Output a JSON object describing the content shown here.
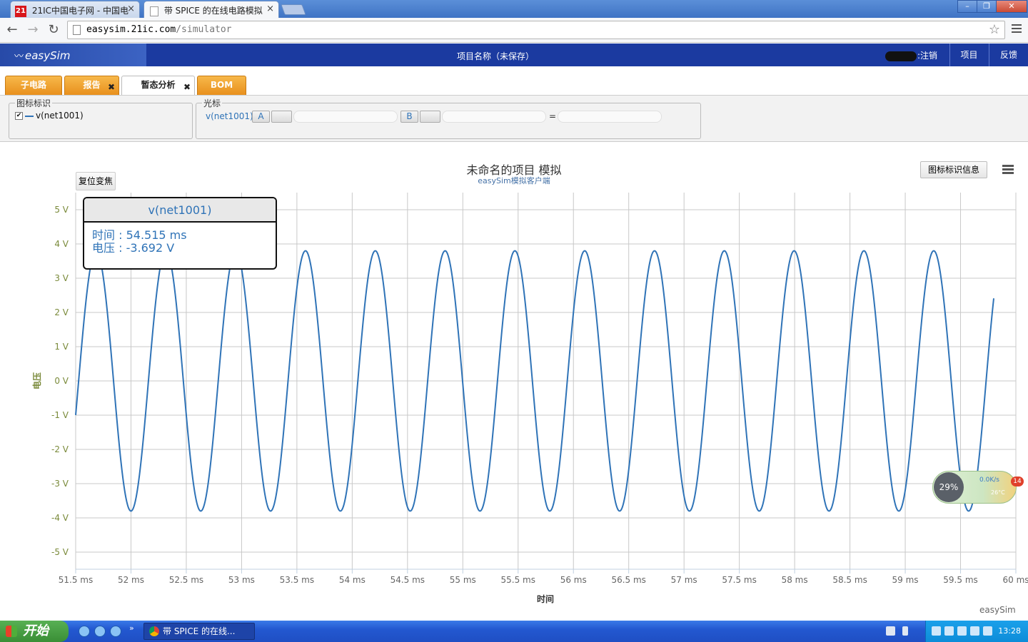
{
  "browser": {
    "tabs": [
      {
        "title": "21IC中国电子网 - 中国电",
        "favicon": "21",
        "active": false
      },
      {
        "title": "带 SPICE 的在线电路模拟",
        "favicon": "page-icon",
        "active": true
      }
    ],
    "url_host": "easysim.21ic.com",
    "url_path": "/simulator",
    "window_controls": [
      "minimize-icon",
      "maximize-icon",
      "close-icon"
    ]
  },
  "app": {
    "logo": "easySim",
    "project_title": "项目名称（未保存）",
    "user_action": ":注销",
    "nav": {
      "project": "项目",
      "feedback": "反馈"
    }
  },
  "module_tabs": [
    {
      "label": "子电路",
      "closable": false,
      "active": false
    },
    {
      "label": "报告",
      "closable": true,
      "active": false
    },
    {
      "label": "暂态分析",
      "closable": true,
      "active": true
    },
    {
      "label": "BOM",
      "closable": false,
      "active": false
    }
  ],
  "legend_panel": {
    "title": "图标标识",
    "entries": [
      {
        "name": "v(net1001)",
        "checked": true,
        "color": "#2f73b7"
      }
    ]
  },
  "cursor_panel": {
    "title": "光标",
    "signal": "v(net1001)",
    "cursor_a": "A",
    "cursor_b": "B",
    "equals": "="
  },
  "chart_controls": {
    "reset_zoom": "复位变焦",
    "legend_info": "图标标识信息",
    "credits": "easySim"
  },
  "tooltip": {
    "series": "v(net1001)",
    "time_label": "时间",
    "time_value": "54.515 ms",
    "voltage_label": "电压",
    "voltage_value": "-3.692 V",
    "separator": " : "
  },
  "chart_data": {
    "type": "line",
    "title": "未命名的项目 模拟",
    "subtitle": "easySim模拟客户端",
    "xlabel": "时间",
    "ylabel": "电压",
    "x_unit": "ms",
    "y_unit": "V",
    "xlim": [
      51.5,
      60
    ],
    "ylim": [
      -5.5,
      5.5
    ],
    "x_ticks": [
      51.5,
      52,
      52.5,
      53,
      53.5,
      54,
      54.5,
      55,
      55.5,
      56,
      56.5,
      57,
      57.5,
      58,
      58.5,
      59,
      59.5,
      60
    ],
    "x_tick_labels": [
      "51.5 ms",
      "52 ms",
      "52.5 ms",
      "53 ms",
      "53.5 ms",
      "54 ms",
      "54.5 ms",
      "55 ms",
      "55.5 ms",
      "56 ms",
      "56.5 ms",
      "57 ms",
      "57.5 ms",
      "58 ms",
      "58.5 ms",
      "59 ms",
      "59.5 ms",
      "60 ms"
    ],
    "y_ticks": [
      5,
      4,
      3,
      2,
      1,
      0,
      -1,
      -2,
      -3,
      -4,
      -5
    ],
    "y_tick_labels": [
      "5 V",
      "4 V",
      "3 V",
      "2 V",
      "1 V",
      "0 V",
      "-1 V",
      "-2 V",
      "-3 V",
      "-4 V",
      "-5 V"
    ],
    "grid": true,
    "series": [
      {
        "name": "v(net1001)",
        "color": "#2f73b7",
        "waveform": "sine",
        "amplitude": 3.8,
        "period_ms": 0.6311,
        "x_end": 59.8,
        "x_first_min": 52.0,
        "x_last_value": 2.2
      }
    ]
  },
  "widget": {
    "percent": "29%",
    "speed": "0.0K/s",
    "temp": "26°C",
    "badge": "14"
  },
  "taskbar": {
    "start_label": "开始",
    "task": "带 SPICE 的在线...",
    "clock": "13:28"
  }
}
